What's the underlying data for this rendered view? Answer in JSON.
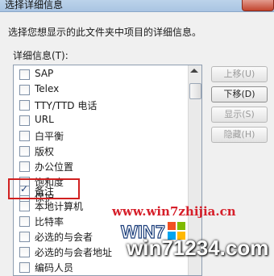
{
  "window": {
    "title": "选择详细信息"
  },
  "intro_text": "选择您想显示的此文件夹中项目的详细信息。",
  "details_label": "详细信息(T):",
  "details_list": [
    {
      "label": "SAP",
      "checked": false
    },
    {
      "label": "Telex",
      "checked": false
    },
    {
      "label": "TTY/TTD 电话",
      "checked": false
    },
    {
      "label": "URL",
      "checked": false
    },
    {
      "label": "白平衡",
      "checked": false
    },
    {
      "label": "版权",
      "checked": false
    },
    {
      "label": "办公位置",
      "checked": false
    },
    {
      "label": "饱和度",
      "checked": false
    },
    {
      "label": "保护",
      "checked": false
    },
    {
      "label": "备注",
      "checked": true
    },
    {
      "label": "本地计算机",
      "checked": false
    },
    {
      "label": "比特率",
      "checked": false
    },
    {
      "label": "必选的与会者",
      "checked": false
    },
    {
      "label": "必选的与会者地址",
      "checked": false
    },
    {
      "label": "编码人员",
      "checked": false
    }
  ],
  "buttons": {
    "move_up": "上移(U)",
    "move_down": "下移(D)",
    "show": "显示(S)",
    "hide": "隐藏(H)"
  },
  "watermarks": {
    "site1": "www.win7zhijia.cn",
    "logo_text": "WIN7",
    "site2": "win71234.com"
  },
  "check_mark": "✓"
}
